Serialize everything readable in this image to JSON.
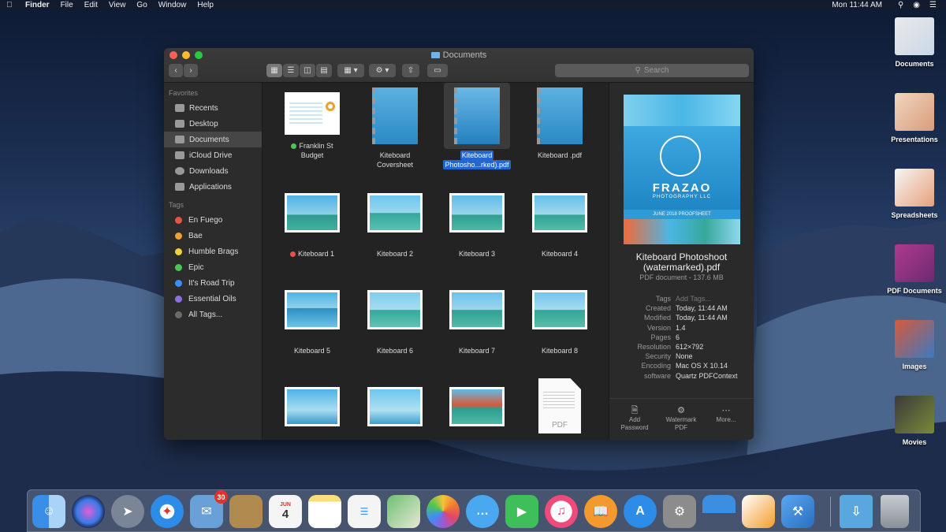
{
  "menubar": {
    "app": "Finder",
    "menus": [
      "File",
      "Edit",
      "View",
      "Go",
      "Window",
      "Help"
    ],
    "clock": "Mon 11:44 AM"
  },
  "desktop_icons": [
    {
      "label": "Documents"
    },
    {
      "label": "Presentations"
    },
    {
      "label": "Spreadsheets"
    },
    {
      "label": "PDF Documents"
    },
    {
      "label": "Images"
    },
    {
      "label": "Movies"
    }
  ],
  "window": {
    "title": "Documents",
    "search_placeholder": "Search"
  },
  "sidebar": {
    "favorites_heading": "Favorites",
    "favorites": [
      {
        "label": "Recents",
        "icon": "clock-icon"
      },
      {
        "label": "Desktop",
        "icon": "desktop-icon"
      },
      {
        "label": "Documents",
        "icon": "document-icon",
        "selected": true
      },
      {
        "label": "iCloud Drive",
        "icon": "cloud-icon"
      },
      {
        "label": "Downloads",
        "icon": "download-icon"
      },
      {
        "label": "Applications",
        "icon": "applications-icon"
      }
    ],
    "tags_heading": "Tags",
    "tags": [
      {
        "label": "En Fuego",
        "color": "#e5534b"
      },
      {
        "label": "Bae",
        "color": "#f0a030"
      },
      {
        "label": "Humble Brags",
        "color": "#f2d13a"
      },
      {
        "label": "Epic",
        "color": "#4cc552"
      },
      {
        "label": "It's Road Trip",
        "color": "#3e8ef7"
      },
      {
        "label": "Essential Oils",
        "color": "#8e6ee0"
      },
      {
        "label": "All Tags...",
        "color": "#6a6a6a"
      }
    ]
  },
  "files": [
    {
      "l1": "Franklin St",
      "l2": "Budget",
      "tag": "#4cc552",
      "kind": "sheet"
    },
    {
      "l1": "Kiteboard",
      "l2": "Coversheet",
      "kind": "doc"
    },
    {
      "l1": "Kiteboard",
      "l2": "Photosho...rked).pdf",
      "kind": "doc",
      "selected": true
    },
    {
      "l1": "Kiteboard .pdf",
      "l2": "",
      "kind": "doc"
    },
    {
      "l1": "Kiteboard 1",
      "l2": "",
      "tag": "#e5534b",
      "kind": "photo"
    },
    {
      "l1": "Kiteboard 2",
      "l2": "",
      "kind": "photo"
    },
    {
      "l1": "Kiteboard 3",
      "l2": "",
      "kind": "photo"
    },
    {
      "l1": "Kiteboard 4",
      "l2": "",
      "kind": "photo"
    },
    {
      "l1": "Kiteboard 5",
      "l2": "",
      "kind": "photo"
    },
    {
      "l1": "Kiteboard 6",
      "l2": "",
      "kind": "photo"
    },
    {
      "l1": "Kiteboard 7",
      "l2": "",
      "kind": "photo"
    },
    {
      "l1": "Kiteboard 8",
      "l2": "",
      "kind": "photo"
    },
    {
      "l1": "",
      "l2": "",
      "kind": "photo"
    },
    {
      "l1": "",
      "l2": "",
      "kind": "photo"
    },
    {
      "l1": "",
      "l2": "",
      "kind": "photo"
    },
    {
      "l1": "",
      "l2": "",
      "kind": "pdf",
      "badge": "PDF"
    }
  ],
  "preview": {
    "image_brand": "FRAZAO",
    "image_sub": "PHOTOGRAPHY LLC",
    "image_caption": "JUNE 2018 PROOFSHEET",
    "name_line1": "Kiteboard  Photoshoot",
    "name_line2": "(watermarked).pdf",
    "subtitle": "PDF document - 137.6 MB",
    "meta": [
      {
        "k": "Tags",
        "v": "Add Tags...",
        "dim": true
      },
      {
        "k": "Created",
        "v": "Today, 11:44 AM"
      },
      {
        "k": "Modified",
        "v": "Today, 11:44 AM"
      },
      {
        "k": "Version",
        "v": "1.4"
      },
      {
        "k": "Pages",
        "v": "6"
      },
      {
        "k": "Resolution",
        "v": "612×792"
      },
      {
        "k": "Security",
        "v": "None"
      },
      {
        "k": "Encoding",
        "v": "Mac OS X 10.14"
      },
      {
        "k": "software",
        "v": "Quartz PDFContext"
      }
    ],
    "actions": [
      {
        "l1": "Add",
        "l2": "Password",
        "icon": "lock-doc-icon"
      },
      {
        "l1": "Watermark",
        "l2": "PDF",
        "icon": "watermark-icon"
      },
      {
        "l1": "More...",
        "l2": "",
        "icon": "more-icon"
      }
    ]
  },
  "dock": {
    "mail_badge": "30",
    "calendar_month": "JUN",
    "calendar_day": "4",
    "apps": [
      {
        "name": "finder-icon",
        "color": "#3b8ee8"
      },
      {
        "name": "siri-icon",
        "color": "#3a2a70"
      },
      {
        "name": "launchpad-icon",
        "color": "#7a8598"
      },
      {
        "name": "safari-icon",
        "color": "#2d8ce8"
      },
      {
        "name": "mail-icon",
        "color": "#6aa0d8"
      },
      {
        "name": "contacts-icon",
        "color": "#b08a4e"
      },
      {
        "name": "calendar-icon",
        "color": "#f5f5f5"
      },
      {
        "name": "notes-icon",
        "color": "#f7e07a"
      },
      {
        "name": "reminders-icon",
        "color": "#f4f4f4"
      },
      {
        "name": "maps-icon",
        "color": "#6cc070"
      },
      {
        "name": "photos-icon",
        "color": "#f6f6f6"
      },
      {
        "name": "messages-icon",
        "color": "#4aa8f0"
      },
      {
        "name": "facetime-icon",
        "color": "#3fbf5a"
      },
      {
        "name": "itunes-icon",
        "color": "#f04a7c"
      },
      {
        "name": "books-icon",
        "color": "#f29a2e"
      },
      {
        "name": "app-store-icon",
        "color": "#2d8ce8"
      },
      {
        "name": "system-preferences-icon",
        "color": "#8c8c8c"
      },
      {
        "name": "keynote-icon",
        "color": "#3c8ee0"
      },
      {
        "name": "pages-icon",
        "color": "#f39c2a"
      },
      {
        "name": "xcode-icon",
        "color": "#3f86d9"
      },
      {
        "name": "downloads-folder-icon",
        "color": "#5aa7e0"
      },
      {
        "name": "trash-icon",
        "color": "#9aa0a8"
      }
    ]
  }
}
